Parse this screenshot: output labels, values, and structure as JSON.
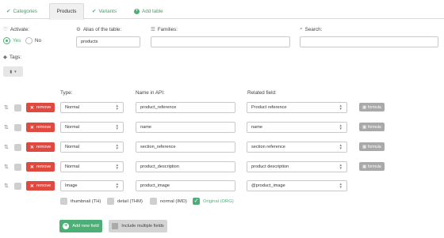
{
  "tabs": [
    {
      "label": "Categories",
      "icon": "check-icon"
    },
    {
      "label": "Products",
      "icon": ""
    },
    {
      "label": "Variants",
      "icon": "check-icon"
    },
    {
      "label": "Add table",
      "icon": "plus-circle-icon"
    }
  ],
  "form": {
    "activate_label": "Activate:",
    "yes_label": "Yes",
    "no_label": "No",
    "activate_selected": "Yes",
    "alias_label": "Alias of the table:",
    "alias_value": "products",
    "families_label": "Families:",
    "families_value": "",
    "search_label": "Search:",
    "search_value": "",
    "tags_label": "Tags:"
  },
  "columns": {
    "type": "Type:",
    "name": "Name in API:",
    "related": "Related field:"
  },
  "rows": [
    {
      "remove": "remove",
      "type": "Normal",
      "name": "product_reference",
      "related": "Product reference",
      "formula": "formula"
    },
    {
      "remove": "remove",
      "type": "Normal",
      "name": "name",
      "related": "name",
      "formula": "formula"
    },
    {
      "remove": "remove",
      "type": "Normal",
      "name": "section_reference",
      "related": "section reference",
      "formula": "formula"
    },
    {
      "remove": "remove",
      "type": "Normal",
      "name": "product_description",
      "related": "product description",
      "formula": "formula"
    },
    {
      "remove": "remove",
      "type": "Image",
      "name": "product_image",
      "related": "@product_image",
      "formula": ""
    }
  ],
  "image_options": [
    {
      "label": "thumbnail (TH)",
      "checked": false
    },
    {
      "label": "detail (THM)",
      "checked": false
    },
    {
      "label": "normal (IMD)",
      "checked": false
    },
    {
      "label": "Original (ORG)",
      "checked": true
    }
  ],
  "buttons": {
    "add_new_field": "Add new field",
    "include_multiple": "Include multiple fields"
  },
  "colors": {
    "accent": "#4caf76",
    "danger": "#e0493f",
    "muted_button": "#a9a9a9"
  }
}
